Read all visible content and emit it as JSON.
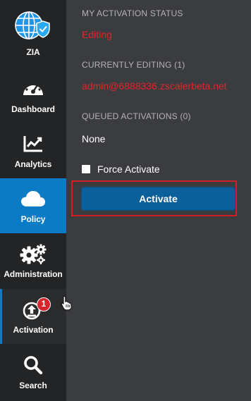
{
  "sidebar": {
    "items": [
      {
        "key": "zia",
        "label": "ZIA",
        "icon": "globe-shield-icon"
      },
      {
        "key": "dashboard",
        "label": "Dashboard",
        "icon": "speedometer-icon"
      },
      {
        "key": "analytics",
        "label": "Analytics",
        "icon": "line-chart-icon"
      },
      {
        "key": "policy",
        "label": "Policy",
        "icon": "cloud-icon",
        "active": true
      },
      {
        "key": "administration",
        "label": "Administration",
        "icon": "gears-icon"
      },
      {
        "key": "activation",
        "label": "Activation",
        "icon": "upload-icon",
        "badge": "1"
      },
      {
        "key": "search",
        "label": "Search",
        "icon": "search-icon"
      }
    ]
  },
  "activation_panel": {
    "status_heading": "MY ACTIVATION STATUS",
    "status_value": "Editing",
    "editing_heading": "CURRENTLY EDITING (1)",
    "editing_user": "admin@6888336.zscalerbeta.net",
    "queued_heading": "QUEUED ACTIVATIONS (0)",
    "queued_value": "None",
    "force_activate_label": "Force Activate",
    "force_activate_checked": false,
    "activate_button": "Activate"
  },
  "colors": {
    "sidebar_bg": "#232426",
    "panel_bg": "#3b3c3f",
    "active_nav": "#0b7bc6",
    "alert_red": "#e0242b",
    "button_blue": "#0b5f9a",
    "badge_red": "#d8262d"
  }
}
